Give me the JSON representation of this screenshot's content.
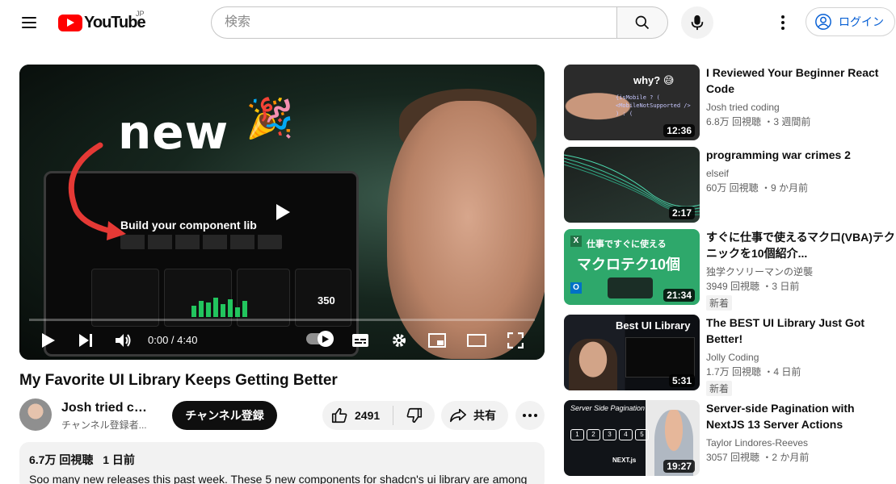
{
  "header": {
    "logo_text": "YouTube",
    "region": "JP",
    "search_placeholder": "検索",
    "login_label": "ログイン"
  },
  "player": {
    "thumbnail_headline": "new",
    "thumbnail_laptop_title": "Build your component lib",
    "thumbnail_stat": "350",
    "time_display": "0:00 / 4:40",
    "progress": 0.0
  },
  "video": {
    "title": "My Favorite UI Library Keeps Getting Better",
    "channel_name": "Josh tried co...",
    "channel_subs": "チャンネル登録者...",
    "subscribe_label": "チャンネル登録",
    "like_count": "2491",
    "share_label": "共有",
    "views": "6.7万 回視聴",
    "age": "1 日前",
    "description": "Soo many new releases this past week. These 5 new components for shadcn's ui library are among"
  },
  "recommendations": [
    {
      "title": "I Reviewed Your Beginner React Code",
      "channel": "Josh tried coding",
      "meta": "6.8万 回視聴 ・3 週間前",
      "duration": "12:36",
      "thumb_text": "why? 😅",
      "thumb_code": "{isMobile ? ( <MobileNotSupported /> ) : ("
    },
    {
      "title": "programming war crimes 2",
      "channel": "elseif",
      "meta": "60万 回視聴 ・9 か月前",
      "duration": "2:17"
    },
    {
      "title": "すぐに仕事で使えるマクロ(VBA)テクニックを10個紹介...",
      "channel": "独学クソリーマンの逆襲",
      "meta": "3949 回視聴 ・3 日前",
      "duration": "21:34",
      "badge": "新着",
      "thumb_text": "仕事ですぐに使える",
      "thumb_text2": "マクロテク10個"
    },
    {
      "title": "The BEST UI Library Just Got Better!",
      "channel": "Jolly Coding",
      "meta": "1.7万 回視聴 ・4 日前",
      "duration": "5:31",
      "badge": "新着",
      "thumb_text": "Best UI Library"
    },
    {
      "title": "Server-side Pagination with NextJS 13 Server Actions",
      "channel": "Taylor Lindores-Reeves",
      "meta": "3057 回視聴 ・2 か月前",
      "duration": "19:27",
      "thumb_text": "Server Side Pagination",
      "thumb_text2": "NEXT.js",
      "thumb_pages": [
        "1",
        "2",
        "3",
        "4",
        "5"
      ]
    }
  ],
  "colors": {
    "brand_red": "#ff0000",
    "link_blue": "#065fd4",
    "chip_gray": "#f2f2f2",
    "text_secondary": "#606060"
  }
}
